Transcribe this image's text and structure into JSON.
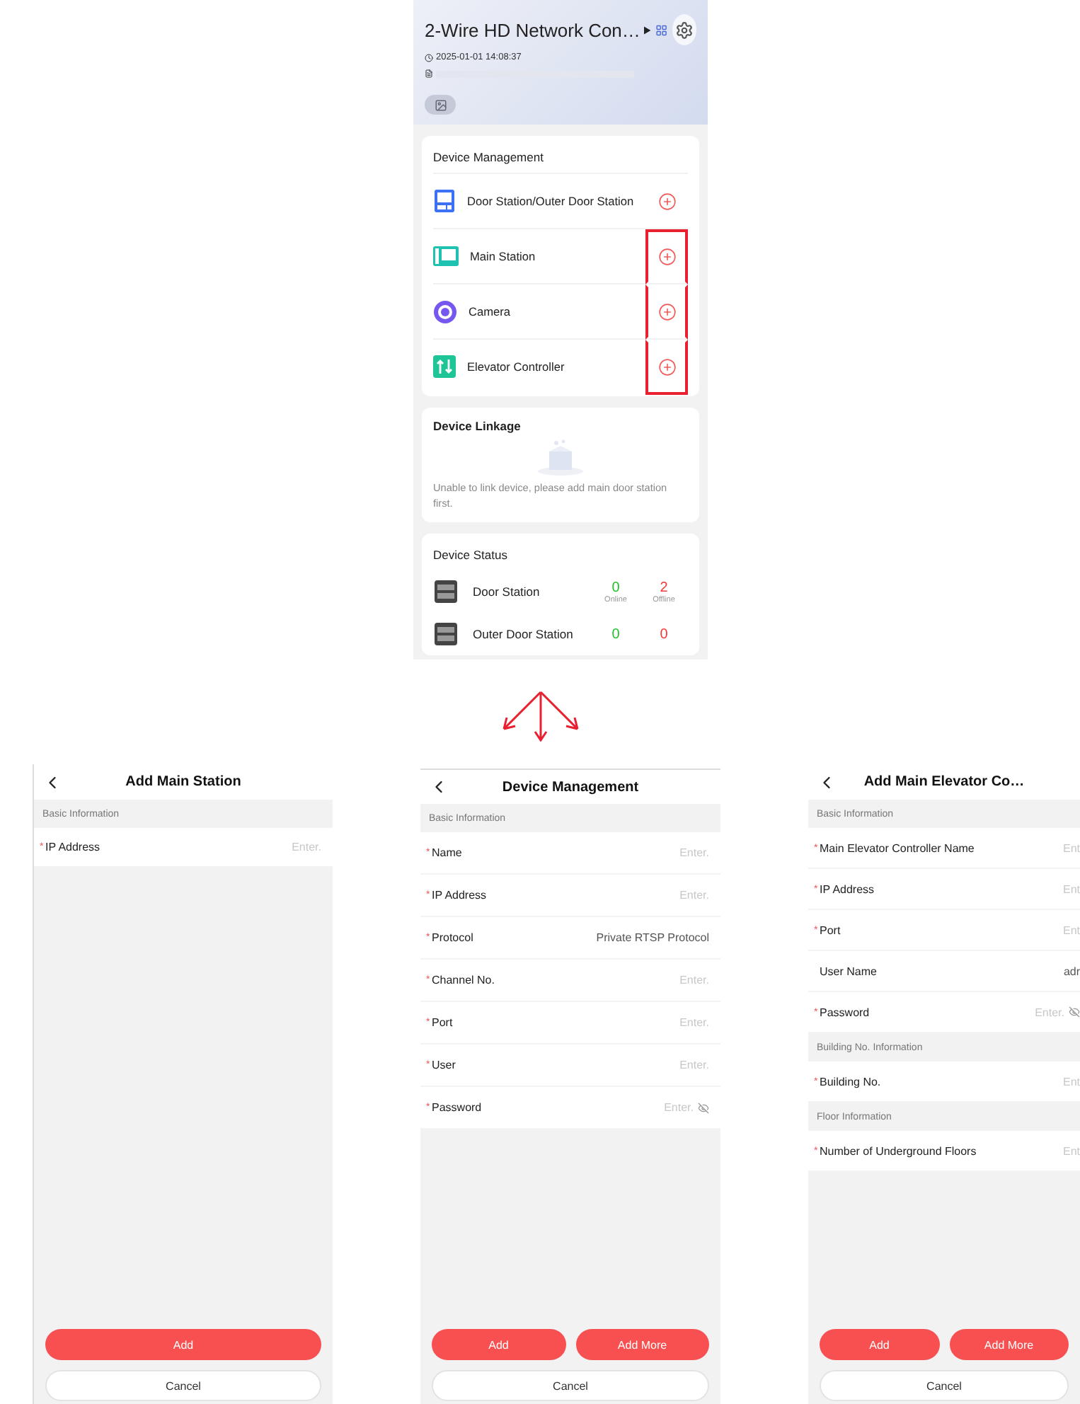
{
  "overview": {
    "title": "2-Wire HD Network Con…",
    "time": "2025-01-01 14:08:37",
    "device_management": {
      "title": "Device Management",
      "items": [
        {
          "kind": "door",
          "label": "Door Station/Outer Door Station",
          "highlighted": false
        },
        {
          "kind": "main",
          "label": "Main Station",
          "highlighted": true
        },
        {
          "kind": "camera",
          "label": "Camera",
          "highlighted": true
        },
        {
          "kind": "elevator",
          "label": "Elevator Controller",
          "highlighted": true
        }
      ]
    },
    "linkage": {
      "title": "Device Linkage",
      "message": "Unable to link device, please add main door station first."
    },
    "status": {
      "title": "Device Status",
      "rows": [
        {
          "name": "Door Station",
          "online": "0",
          "online_label": "Online",
          "offline": "2",
          "offline_label": "Offline"
        },
        {
          "name": "Outer Door Station",
          "online": "0",
          "offline": "0"
        }
      ]
    }
  },
  "forms": [
    {
      "title": "Add Main Station",
      "required_mark": "*",
      "sections": [
        {
          "title": "Basic Information",
          "fields": [
            {
              "kind": "text",
              "label": "IP Address",
              "required": true,
              "placeholder": "Enter."
            }
          ]
        }
      ],
      "buttons": [
        {
          "kind": "primary",
          "label": "Add"
        },
        {
          "kind": "secondary",
          "label": "Cancel"
        }
      ]
    },
    {
      "title": "Device Management",
      "required_mark": "*",
      "sections": [
        {
          "title": "Basic Information",
          "fields": [
            {
              "kind": "text",
              "label": "Name",
              "required": true,
              "placeholder": "Enter."
            },
            {
              "kind": "text",
              "label": "IP Address",
              "required": true,
              "placeholder": "Enter."
            },
            {
              "kind": "text",
              "label": "Protocol",
              "required": true,
              "value": "Private RTSP Protocol"
            },
            {
              "kind": "text",
              "label": "Channel No.",
              "required": true,
              "placeholder": "Enter."
            },
            {
              "kind": "text",
              "label": "Port",
              "required": true,
              "placeholder": "Enter."
            },
            {
              "kind": "text",
              "label": "User",
              "required": true,
              "placeholder": "Enter."
            },
            {
              "kind": "password",
              "label": "Password",
              "required": true,
              "placeholder": "Enter."
            }
          ]
        }
      ],
      "buttons": [
        {
          "kind": "primary",
          "label": "Add"
        },
        {
          "kind": "primary",
          "label": "Add More"
        },
        {
          "kind": "secondary",
          "label": "Cancel"
        }
      ]
    },
    {
      "title": "Add Main Elevator Co…",
      "required_mark": "*",
      "sections": [
        {
          "title": "Basic Information",
          "fields": [
            {
              "kind": "text",
              "label": "Main Elevator Controller Name",
              "required": true,
              "placeholder": "Ent"
            },
            {
              "kind": "text",
              "label": "IP Address",
              "required": true,
              "placeholder": "Ent"
            },
            {
              "kind": "text",
              "label": "Port",
              "required": true,
              "placeholder": "Ent"
            },
            {
              "kind": "text",
              "label": "User Name",
              "required": false,
              "value": "adr"
            },
            {
              "kind": "password",
              "label": "Password",
              "required": true,
              "placeholder": "Enter."
            }
          ]
        },
        {
          "title": "Building No. Information",
          "fields": [
            {
              "kind": "text",
              "label": "Building No.",
              "required": true,
              "placeholder": "Ent"
            }
          ]
        },
        {
          "title": "Floor Information",
          "fields": [
            {
              "kind": "text",
              "label": "Number of Underground Floors",
              "required": true,
              "placeholder": "Ent"
            }
          ]
        }
      ],
      "buttons": [
        {
          "kind": "primary",
          "label": "Add"
        },
        {
          "kind": "primary",
          "label": "Add More"
        },
        {
          "kind": "secondary",
          "label": "Cancel"
        }
      ]
    }
  ]
}
